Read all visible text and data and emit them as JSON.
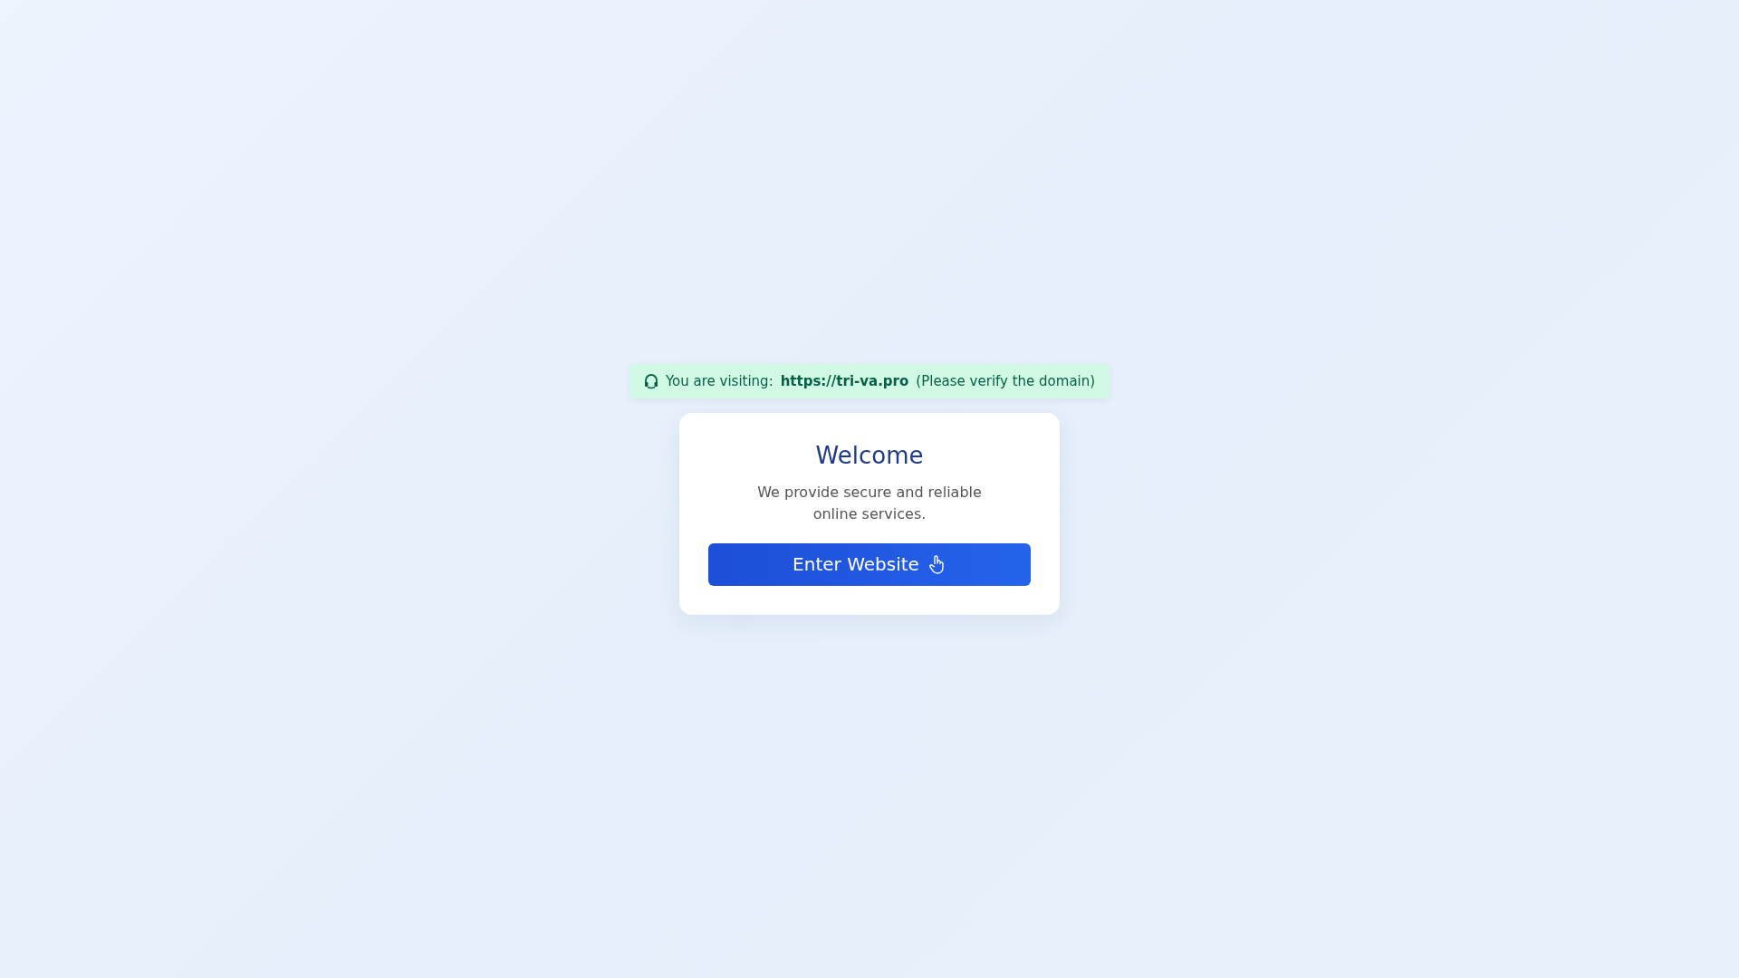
{
  "banner": {
    "label": "You are visiting:",
    "url": "https://tri-va.pro",
    "note": "(Please verify the domain)"
  },
  "card": {
    "title": "Welcome",
    "text": "We provide secure and reliable online services.",
    "button": "Enter Website"
  }
}
